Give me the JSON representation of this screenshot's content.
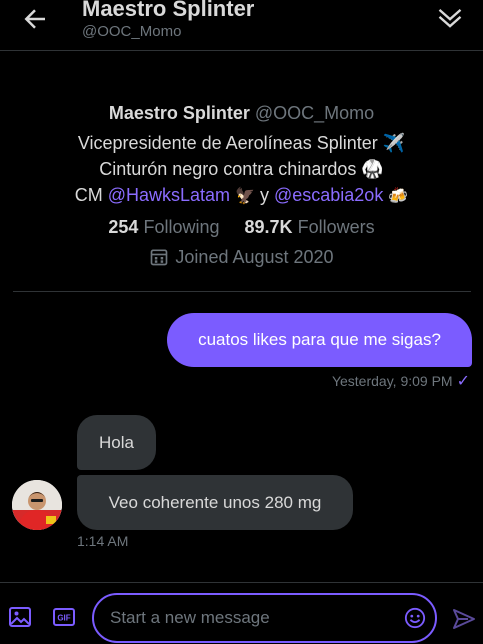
{
  "header": {
    "name": "Maestro Splinter",
    "handle": "@OOC_Momo",
    "back_icon": "arrow-left-icon",
    "collapse_icon": "double-chevron-down-icon"
  },
  "profile": {
    "name": "Maestro Splinter",
    "handle": "@OOC_Momo",
    "bio_line1": "Vicepresidente de Aerolíneas Splinter ✈️",
    "bio_line2": "Cinturón negro contra chinardos 🥋",
    "bio_cm": "CM ",
    "bio_link1": "@HawksLatam",
    "bio_emoji1": "🦅",
    "bio_and": " y ",
    "bio_link2": "@escabia2ok",
    "bio_emoji2": "🍻",
    "following_count": "254",
    "following_label": "Following",
    "followers_count": "89.7K",
    "followers_label": "Followers",
    "joined": "Joined August 2020"
  },
  "messages": {
    "outgoing": {
      "text": "cuatos likes para que me sigas?",
      "time": "Yesterday, 9:09 PM",
      "status": "✓"
    },
    "incoming": [
      {
        "text": "Hola"
      },
      {
        "text": "Veo coherente unos 280 mg"
      }
    ],
    "incoming_time": "1:14 AM"
  },
  "composer": {
    "placeholder": "Start a new message"
  },
  "colors": {
    "accent": "#7b5cff",
    "background": "#000000",
    "bubble_incoming": "#2f3336",
    "muted_text": "#6e767d"
  }
}
